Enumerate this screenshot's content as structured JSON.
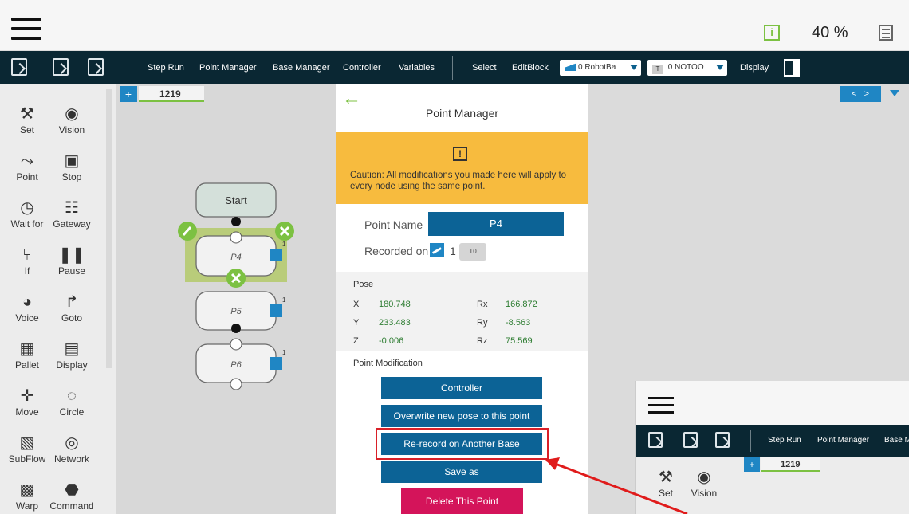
{
  "app": {
    "speed": "40 %"
  },
  "toolbar": {
    "step_run": "Step Run",
    "point_manager": "Point Manager",
    "base_manager": "Base Manager",
    "controller": "Controller",
    "variables": "Variables",
    "select": "Select",
    "edit_block": "EditBlock",
    "base_select": "0 RobotBa",
    "tool_select_badge": "T",
    "tool_select": "0 NOTOO",
    "display": "Display"
  },
  "palette": [
    {
      "label": "Set",
      "icon": "set-icon"
    },
    {
      "label": "Vision",
      "icon": "vision-icon"
    },
    {
      "label": "Point",
      "icon": "point-icon"
    },
    {
      "label": "Stop",
      "icon": "stop-icon"
    },
    {
      "label": "Wait for",
      "icon": "wait-for-icon"
    },
    {
      "label": "Gateway",
      "icon": "gateway-icon"
    },
    {
      "label": "If",
      "icon": "if-icon"
    },
    {
      "label": "Pause",
      "icon": "pause-icon"
    },
    {
      "label": "Voice",
      "icon": "voice-icon"
    },
    {
      "label": "Goto",
      "icon": "goto-icon"
    },
    {
      "label": "Pallet",
      "icon": "pallet-icon"
    },
    {
      "label": "Display",
      "icon": "display-icon"
    },
    {
      "label": "Move",
      "icon": "move-icon"
    },
    {
      "label": "Circle",
      "icon": "circle-icon"
    },
    {
      "label": "SubFlow",
      "icon": "subflow-icon"
    },
    {
      "label": "Network",
      "icon": "network-icon"
    },
    {
      "label": "Warp",
      "icon": "warp-icon"
    },
    {
      "label": "Command",
      "icon": "command-icon"
    }
  ],
  "flow": {
    "tab_add": "+",
    "tab_name": "1219",
    "start_label": "Start",
    "nodes": [
      {
        "label": "P4",
        "badge": "1"
      },
      {
        "label": "P5",
        "badge": "1"
      },
      {
        "label": "P6",
        "badge": "1"
      }
    ]
  },
  "nav": {
    "prev": "<",
    "next": ">"
  },
  "point_manager": {
    "title": "Point Manager",
    "caution_icon": "!",
    "caution_text": "Caution: All modifications you made here will apply to every node using the same point.",
    "point_name_label": "Point Name",
    "point_name_value": "P4",
    "recorded_on_label": "Recorded on",
    "recorded_on_base": "1",
    "recorded_on_tool": "T0",
    "pose_title": "Pose",
    "pose": {
      "x_label": "X",
      "x": "180.748",
      "y_label": "Y",
      "y": "233.483",
      "z_label": "Z",
      "z": "-0.006",
      "rx_label": "Rx",
      "rx": "166.872",
      "ry_label": "Ry",
      "ry": "-8.563",
      "rz_label": "Rz",
      "rz": "75.569"
    },
    "modification_title": "Point Modification",
    "buttons": {
      "controller": "Controller",
      "overwrite": "Overwrite new pose to this point",
      "rerecord": "Re-record on Another Base",
      "save_as": "Save as",
      "delete": "Delete This Point"
    }
  },
  "inset": {
    "step_run": "Step Run",
    "point_manager": "Point Manager",
    "base_manager": "Base M",
    "tab_add": "+",
    "tab_name": "1219",
    "set": "Set",
    "vision": "Vision"
  },
  "colors": {
    "accent_blue": "#0c6396",
    "caution_yellow": "#f7bb3e",
    "delete_pink": "#d4145a",
    "highlight_red": "#d92028",
    "node_green": "#7cc142"
  }
}
